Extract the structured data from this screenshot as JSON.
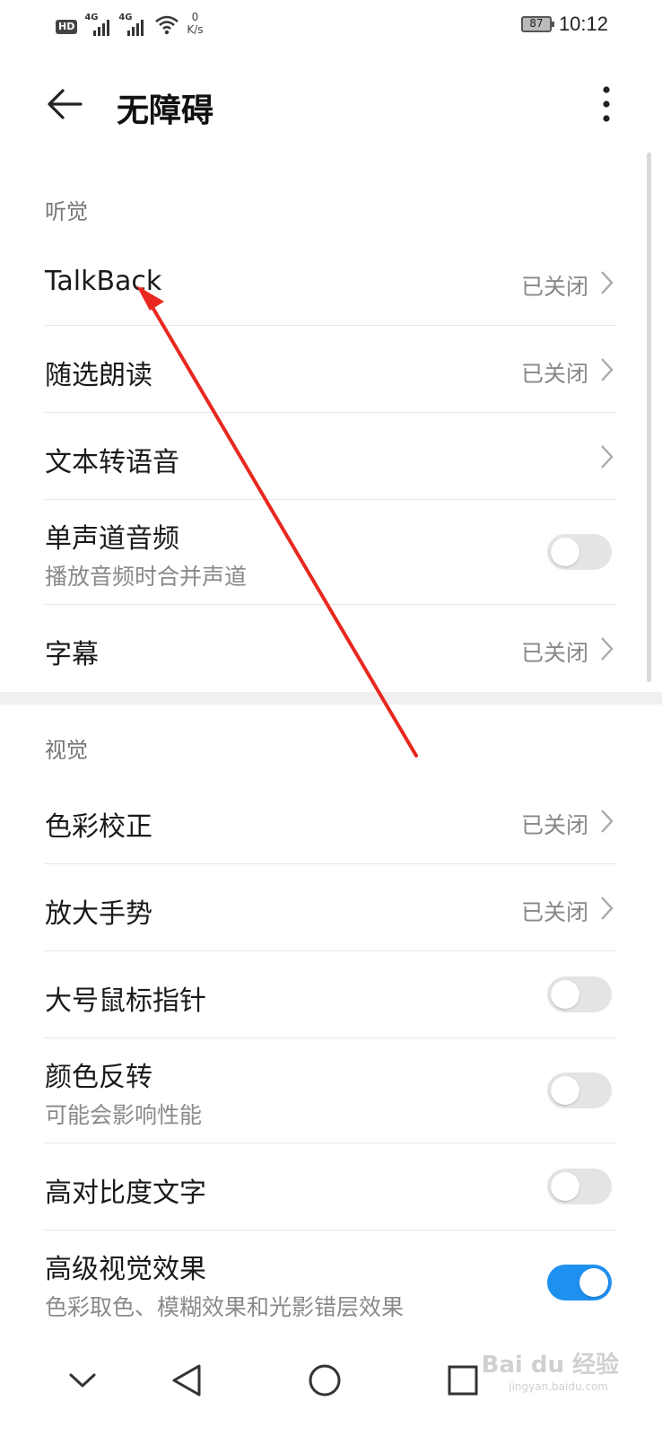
{
  "status_bar": {
    "hd": "HD",
    "net1": "4G",
    "net2": "4G",
    "speed_value": "0",
    "speed_unit": "K/s",
    "battery": "87",
    "time": "10:12"
  },
  "toolbar": {
    "title": "无障碍",
    "back_icon": "arrow-left-icon",
    "more_icon": "more-vertical-icon"
  },
  "hearing": {
    "section_title": "听觉",
    "items": [
      {
        "label": "TalkBack",
        "value": "已关闭"
      },
      {
        "label": "随选朗读",
        "value": "已关闭"
      },
      {
        "label": "文本转语音"
      },
      {
        "label": "单声道音频",
        "sub": "播放音频时合并声道",
        "toggle": false
      },
      {
        "label": "字幕",
        "value": "已关闭"
      }
    ]
  },
  "vision": {
    "section_title": "视觉",
    "items": [
      {
        "label": "色彩校正",
        "value": "已关闭"
      },
      {
        "label": "放大手势",
        "value": "已关闭"
      },
      {
        "label": "大号鼠标指针",
        "toggle": false
      },
      {
        "label": "颜色反转",
        "sub": "可能会影响性能",
        "toggle": false
      },
      {
        "label": "高对比度文字",
        "toggle": false
      },
      {
        "label": "高级视觉效果",
        "sub": "色彩取色、模糊效果和光影错层效果",
        "toggle": true
      }
    ]
  },
  "navbar": {
    "icons": [
      "chevron-down-icon",
      "back-triangle-icon",
      "home-circle-icon",
      "recents-square-icon"
    ]
  },
  "watermark": {
    "brand": "Bai du 经验",
    "url": "jingyan.baidu.com"
  },
  "colors": {
    "accent": "#1e90f0",
    "annotation": "#e8281e"
  }
}
